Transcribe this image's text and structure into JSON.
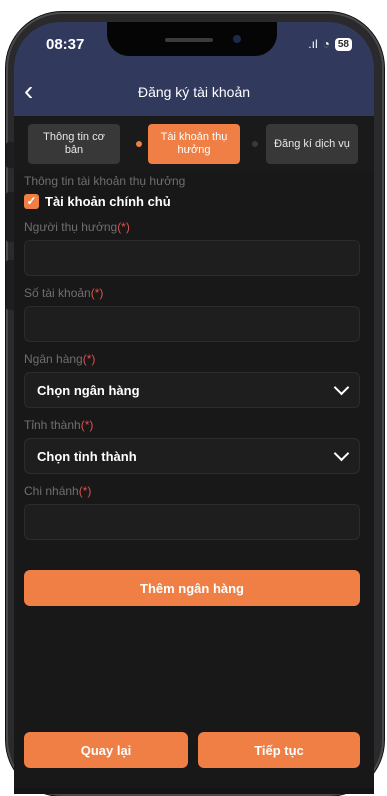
{
  "status_bar": {
    "time": "08:37",
    "signal": ".ıl",
    "wifi": "◔",
    "battery": "58"
  },
  "header": {
    "title": "Đăng ký tài khoản",
    "back_icon": "chevron-left-icon"
  },
  "steps": [
    {
      "label": "Thông tin cơ bản",
      "active": false
    },
    {
      "label": "Tài khoản thụ hưởng",
      "active": true
    },
    {
      "label": "Đăng kí dịch vụ",
      "active": false
    }
  ],
  "form": {
    "section_title": "Thông tin tài khoản thụ hưởng",
    "owner_checkbox_label": "Tài khoản chính chủ",
    "owner_checked": true,
    "beneficiary_label": "Người thụ hưởng",
    "account_number_label": "Số tài khoản",
    "bank_label": "Ngân hàng",
    "bank_select": "Chọn ngân hàng",
    "province_label": "Tỉnh thành",
    "province_select": "Chọn tỉnh thành",
    "branch_label": "Chi nhánh",
    "required_mark": "(*)"
  },
  "actions": {
    "add_bank": "Thêm ngân hàng",
    "back": "Quay lại",
    "continue": "Tiếp tục"
  },
  "colors": {
    "accent": "#ef7f45",
    "header": "#313a5c",
    "background": "#181818"
  }
}
